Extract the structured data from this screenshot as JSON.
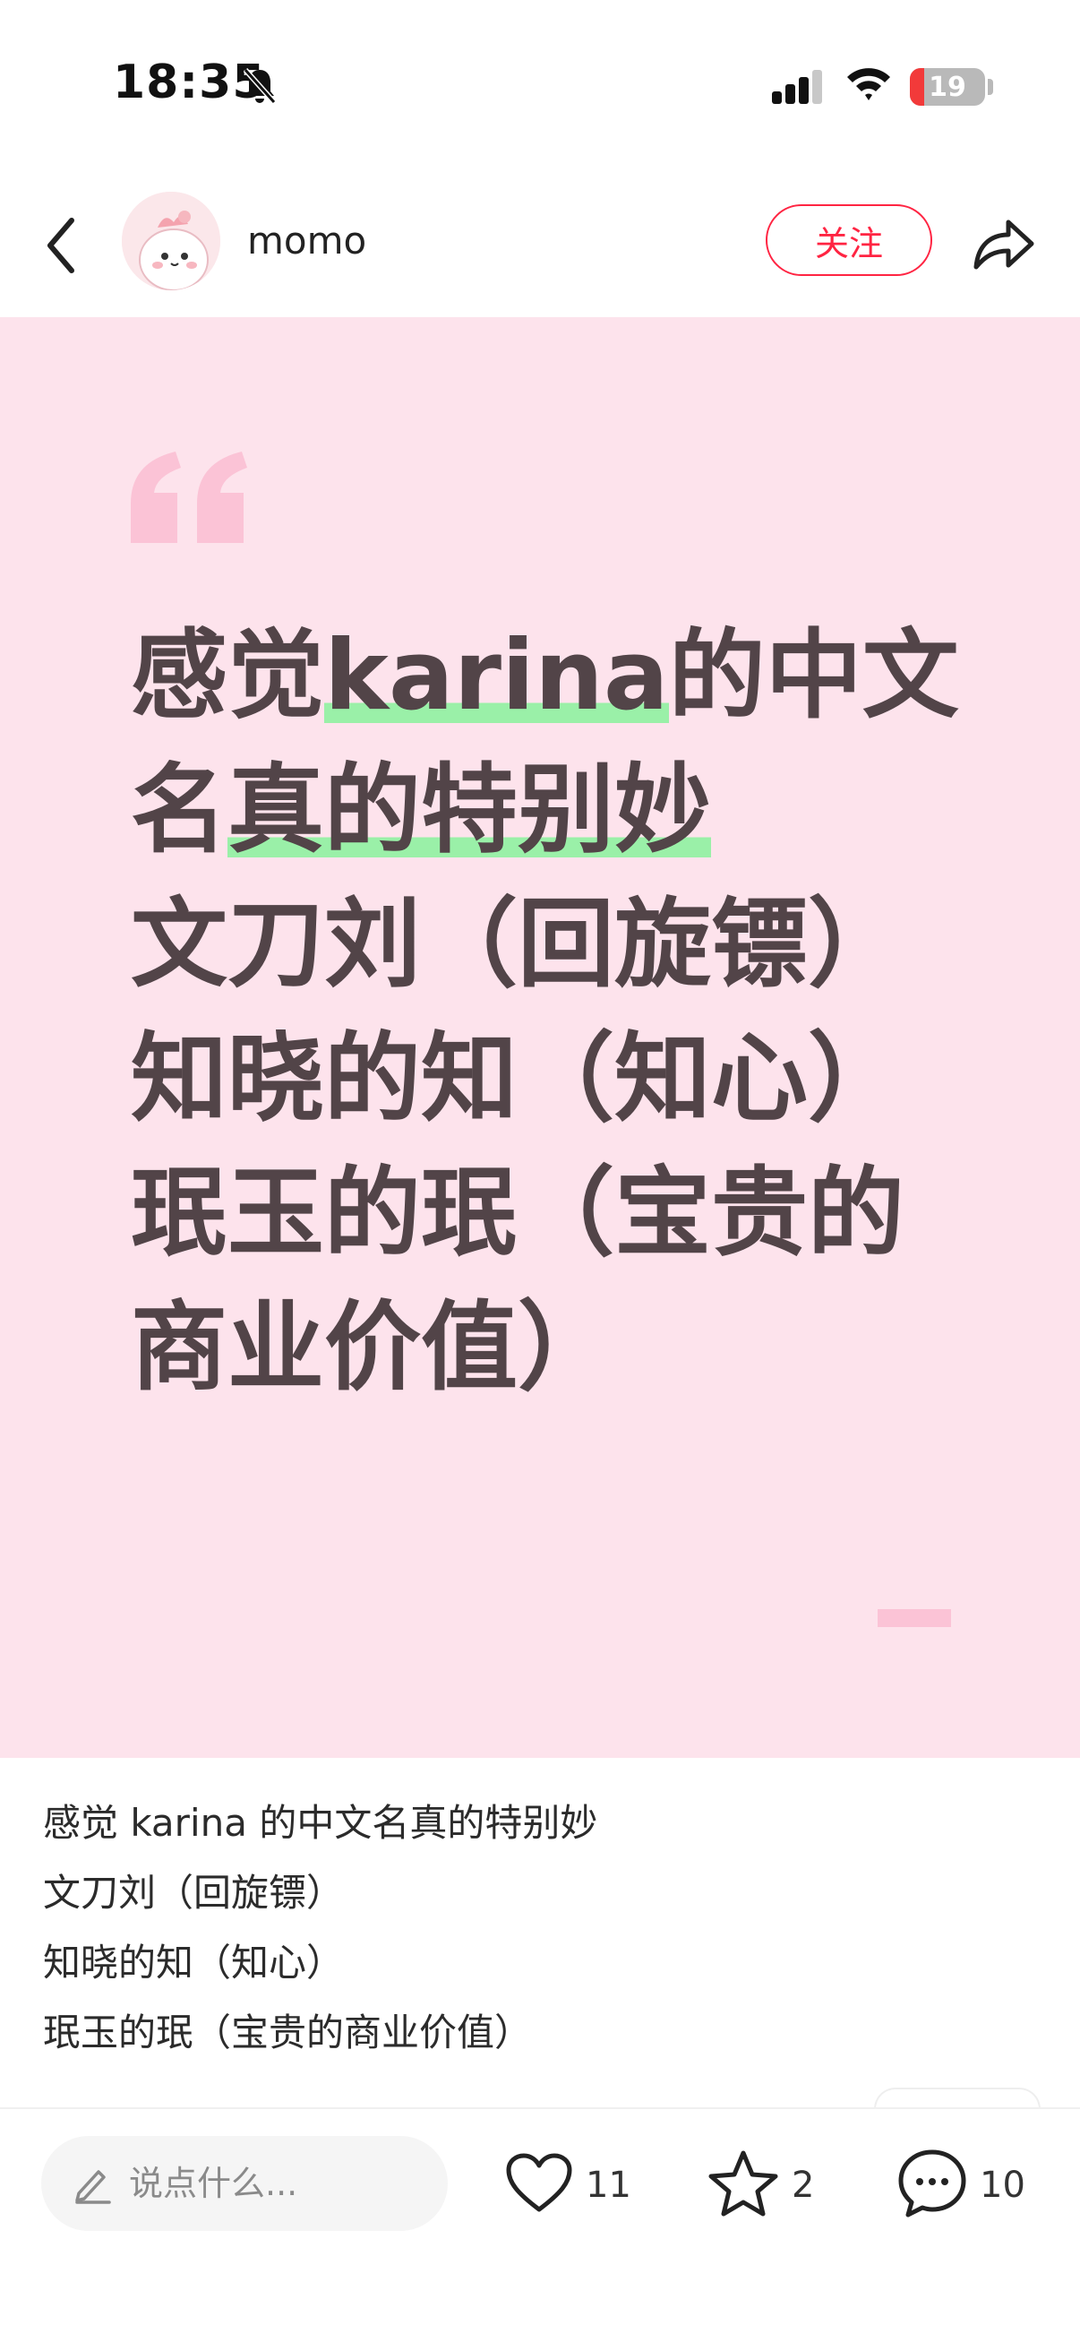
{
  "status_bar": {
    "time": "18:35",
    "battery": "19",
    "battery_level": 0.19
  },
  "header": {
    "author_name": "momo",
    "follow_label": "关注"
  },
  "card": {
    "lines": [
      {
        "pre": "感觉",
        "hl": "karina",
        "post": "的中文"
      },
      {
        "pre": "名",
        "hl": "真的特别妙",
        "post": ""
      },
      {
        "text": "文刀刘（回旋镖）"
      },
      {
        "text": "知晓的知（知心）"
      },
      {
        "text": "珉玉的珉（宝贵的"
      },
      {
        "text": "商业价值）"
      }
    ]
  },
  "caption": {
    "lines": [
      "感觉 karina 的中文名真的特别妙",
      "文刀刘（回旋镖）",
      "知晓的知（知心）",
      "珉玉的珉（宝贵的商业价值）"
    ]
  },
  "bottom_bar": {
    "comment_placeholder": "说点什么...",
    "likes": "11",
    "collects": "2",
    "comments": "10"
  },
  "colors": {
    "accent": "#ff2442",
    "card_bg": "#fde3ec",
    "card_text": "#524448",
    "highlight": "#9af0a8"
  },
  "icons": [
    "bell-slash-icon",
    "signal-icon",
    "wifi-icon",
    "back-icon",
    "share-icon",
    "quote-icon",
    "pencil-icon",
    "heart-icon",
    "star-icon",
    "comment-icon"
  ]
}
